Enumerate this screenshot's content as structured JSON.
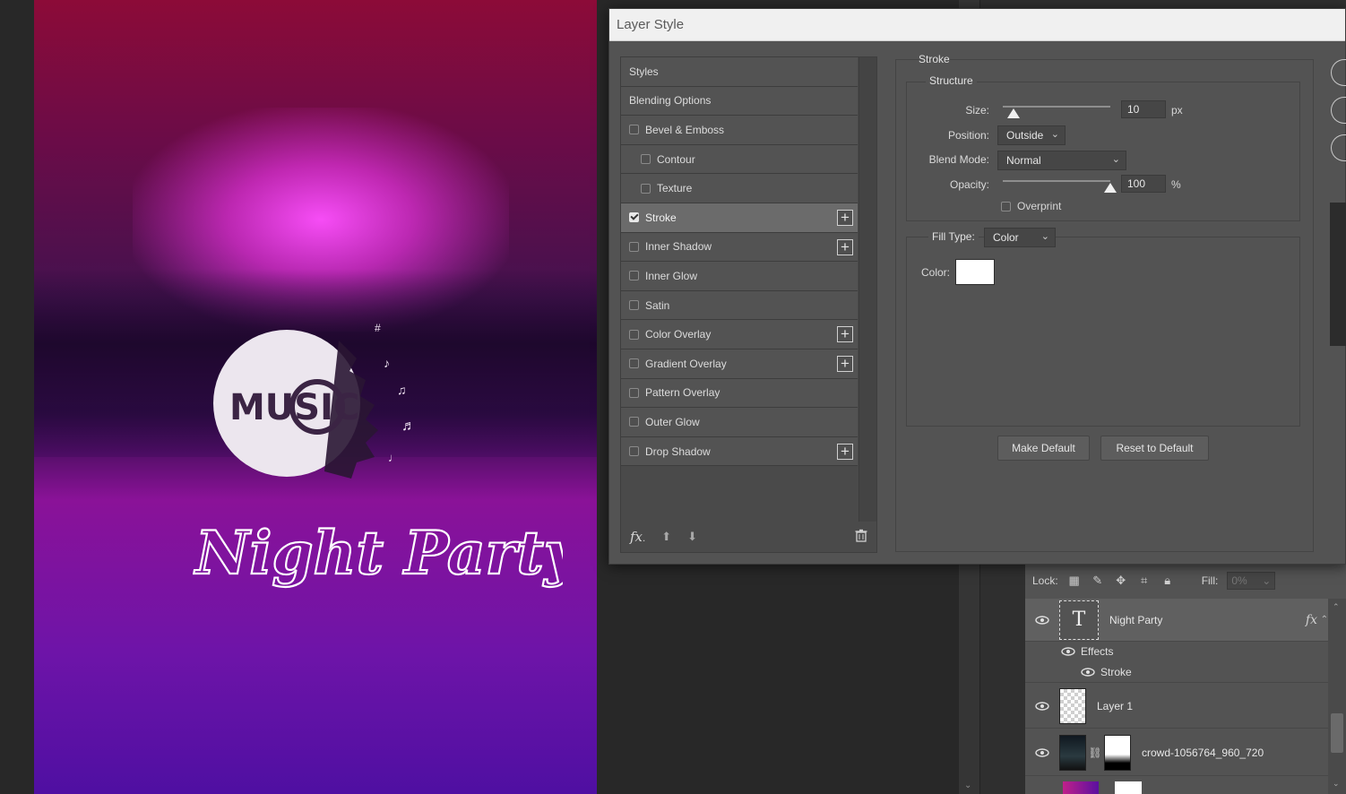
{
  "dialog": {
    "title": "Layer Style",
    "styles_list": [
      {
        "label": "Styles",
        "type": "header"
      },
      {
        "label": "Blending Options",
        "type": "header"
      },
      {
        "label": "Bevel & Emboss",
        "checked": false,
        "plus": false,
        "indent": false
      },
      {
        "label": "Contour",
        "checked": false,
        "plus": false,
        "indent": true
      },
      {
        "label": "Texture",
        "checked": false,
        "plus": false,
        "indent": true
      },
      {
        "label": "Stroke",
        "checked": true,
        "plus": true,
        "indent": false,
        "selected": true
      },
      {
        "label": "Inner Shadow",
        "checked": false,
        "plus": true,
        "indent": false
      },
      {
        "label": "Inner Glow",
        "checked": false,
        "plus": false,
        "indent": false
      },
      {
        "label": "Satin",
        "checked": false,
        "plus": false,
        "indent": false
      },
      {
        "label": "Color Overlay",
        "checked": false,
        "plus": true,
        "indent": false
      },
      {
        "label": "Gradient Overlay",
        "checked": false,
        "plus": true,
        "indent": false
      },
      {
        "label": "Pattern Overlay",
        "checked": false,
        "plus": false,
        "indent": false
      },
      {
        "label": "Outer Glow",
        "checked": false,
        "plus": false,
        "indent": false
      },
      {
        "label": "Drop Shadow",
        "checked": false,
        "plus": true,
        "indent": false
      }
    ],
    "footer": {
      "fx_label": "fx",
      "fx_sub": "."
    },
    "stroke": {
      "section_title": "Stroke",
      "structure_title": "Structure",
      "size_label": "Size:",
      "size_value": "10",
      "size_unit": "px",
      "size_fraction": 0.1,
      "position_label": "Position:",
      "position_value": "Outside",
      "blend_label": "Blend Mode:",
      "blend_value": "Normal",
      "opacity_label": "Opacity:",
      "opacity_value": "100",
      "opacity_unit": "%",
      "opacity_fraction": 1.0,
      "overprint_label": "Overprint",
      "overprint_checked": false,
      "fill_type_label": "Fill Type:",
      "fill_type_value": "Color",
      "color_label": "Color:",
      "color_value": "#ffffff",
      "make_default": "Make Default",
      "reset_default": "Reset to Default"
    }
  },
  "layers": {
    "lock_label": "Lock:",
    "fill_label": "Fill:",
    "fill_value": "0%",
    "items": [
      {
        "name": "Night Party",
        "fx": "fx"
      },
      {
        "name": "Effects"
      },
      {
        "name": "Stroke"
      },
      {
        "name": "Layer 1"
      },
      {
        "name": "crowd-1056764_960_720"
      }
    ]
  },
  "artwork": {
    "logo_text": "MUSIC",
    "title_text": "Night Party"
  },
  "colors": {
    "accent_pink": "#e040e0",
    "purple": "#6e14a8",
    "dialog_bg": "#535353"
  }
}
